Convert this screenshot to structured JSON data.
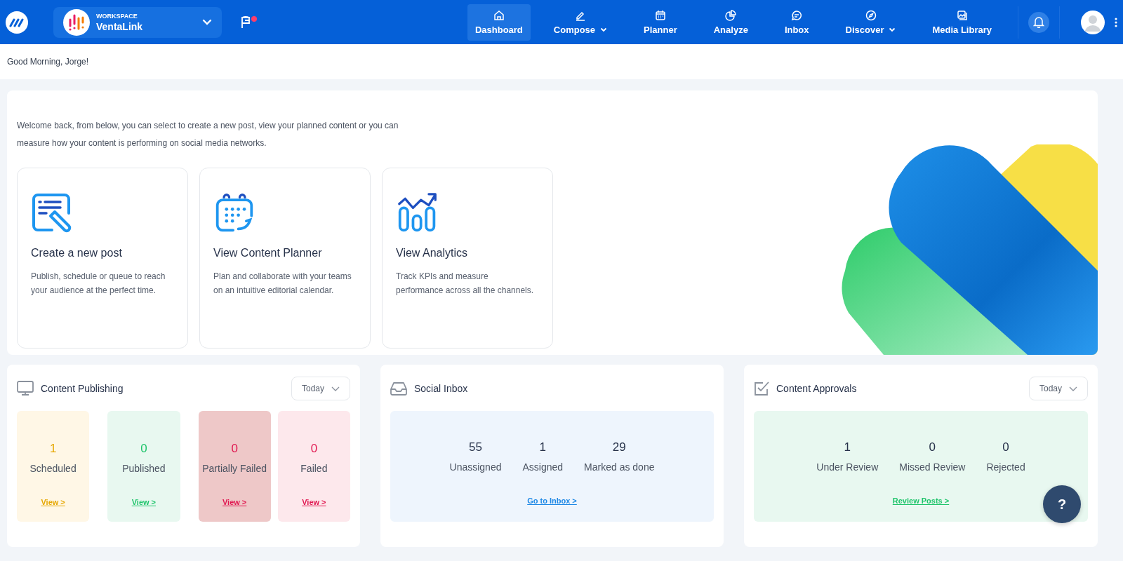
{
  "header": {
    "workspace": {
      "label": "WORKSPACE",
      "name": "VentaLink"
    },
    "flag": {
      "has_notification": true
    },
    "nav": [
      {
        "label": "Dashboard",
        "kind": "home",
        "selected": true,
        "has_menu": false
      },
      {
        "label": "Compose",
        "kind": "compose",
        "selected": false,
        "has_menu": true
      },
      {
        "label": "Planner",
        "kind": "planner",
        "selected": false,
        "has_menu": false
      },
      {
        "label": "Analyze",
        "kind": "analyze",
        "selected": false,
        "has_menu": false
      },
      {
        "label": "Inbox",
        "kind": "inbox",
        "selected": false,
        "has_menu": false
      },
      {
        "label": "Discover",
        "kind": "discover",
        "selected": false,
        "has_menu": true
      },
      {
        "label": "Media Library",
        "kind": "media",
        "selected": false,
        "has_menu": false
      }
    ]
  },
  "greeting": "Good Morning, Jorge!",
  "hero": {
    "intro": "Welcome back, from below, you can select to create a new post, view your planned content or you can measure how your content is performing on social media networks.",
    "cards": [
      {
        "kind": "post",
        "title": "Create a new post",
        "description": "Publish, schedule or queue to reach your audience at the perfect time."
      },
      {
        "kind": "planner",
        "title": "View Content Planner",
        "description": "Plan and collaborate with your teams on an intuitive editorial calendar."
      },
      {
        "kind": "analytics",
        "title": "View Analytics",
        "description": "Track KPIs and measure performance across all the channels."
      }
    ]
  },
  "panels": [
    {
      "kind": "publishing",
      "title": "Content Publishing",
      "filter": "Today",
      "tiles": [
        {
          "kind": "scheduled",
          "count": "1",
          "label": "Scheduled",
          "link": "View >",
          "color": "#e6a700"
        },
        {
          "kind": "published",
          "count": "0",
          "label": "Published",
          "link": "View >",
          "color": "#1fc46b"
        },
        {
          "kind": "partial",
          "count": "0",
          "label": "Partially Failed",
          "link": "View >",
          "color": "#e0164f"
        },
        {
          "kind": "failed",
          "count": "0",
          "label": "Failed",
          "link": "View >",
          "color": "#e0164f"
        }
      ]
    },
    {
      "kind": "inbox",
      "title": "Social Inbox",
      "stats": [
        {
          "count": "55",
          "label": "Unassigned"
        },
        {
          "count": "1",
          "label": "Assigned"
        },
        {
          "count": "29",
          "label": "Marked as done"
        }
      ],
      "link": "Go to Inbox >"
    },
    {
      "kind": "approvals",
      "title": "Content Approvals",
      "filter": "Today",
      "stats": [
        {
          "count": "1",
          "label": "Under Review"
        },
        {
          "count": "0",
          "label": "Missed Review"
        },
        {
          "count": "0",
          "label": "Rejected"
        }
      ],
      "link": "Review Posts >"
    }
  ],
  "help": {
    "label": "?"
  }
}
